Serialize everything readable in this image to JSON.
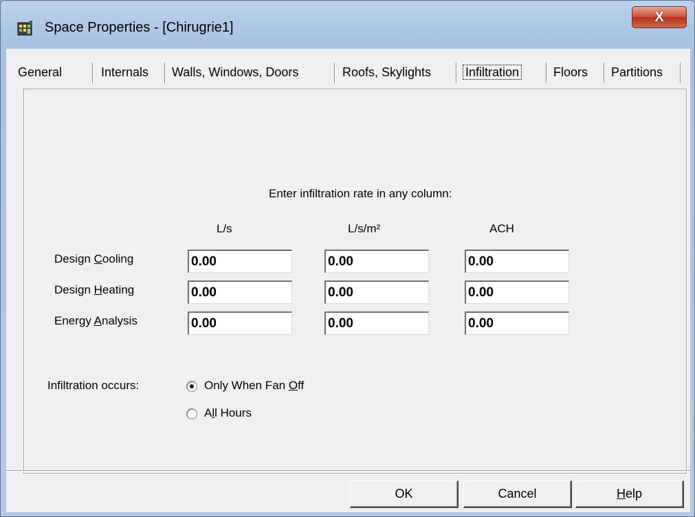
{
  "window": {
    "title": "Space Properties - [Chirugrie1]",
    "close_label": "X"
  },
  "tabs": [
    {
      "label": "General",
      "active": false
    },
    {
      "label": "Internals",
      "active": false
    },
    {
      "label": "Walls, Windows, Doors",
      "active": false
    },
    {
      "label": "Roofs, Skylights",
      "active": false
    },
    {
      "label": "Infiltration",
      "active": true
    },
    {
      "label": "Floors",
      "active": false
    },
    {
      "label": "Partitions",
      "active": false
    }
  ],
  "infiltration": {
    "instruction": "Enter infiltration rate in any column:",
    "columns": [
      "L/s",
      "L/s/m²",
      "ACH"
    ],
    "rows": [
      {
        "label_pre": "Design ",
        "label_mnemonic": "C",
        "label_post": "ooling",
        "values": [
          "0.00",
          "0.00",
          "0.00"
        ]
      },
      {
        "label_pre": "Design ",
        "label_mnemonic": "H",
        "label_post": "eating",
        "values": [
          "0.00",
          "0.00",
          "0.00"
        ]
      },
      {
        "label_pre": "Energy ",
        "label_mnemonic": "A",
        "label_post": "nalysis",
        "values": [
          "0.00",
          "0.00",
          "0.00"
        ]
      }
    ],
    "occurs_label": "Infiltration occurs:",
    "options": [
      {
        "pre": "Only When Fan ",
        "mnemonic": "O",
        "post": "ff",
        "checked": true
      },
      {
        "pre": "A",
        "mnemonic": "l",
        "post": "l Hours",
        "checked": false
      }
    ]
  },
  "buttons": {
    "ok": "OK",
    "cancel": "Cancel",
    "help_mnemonic": "H",
    "help_rest": "elp"
  }
}
